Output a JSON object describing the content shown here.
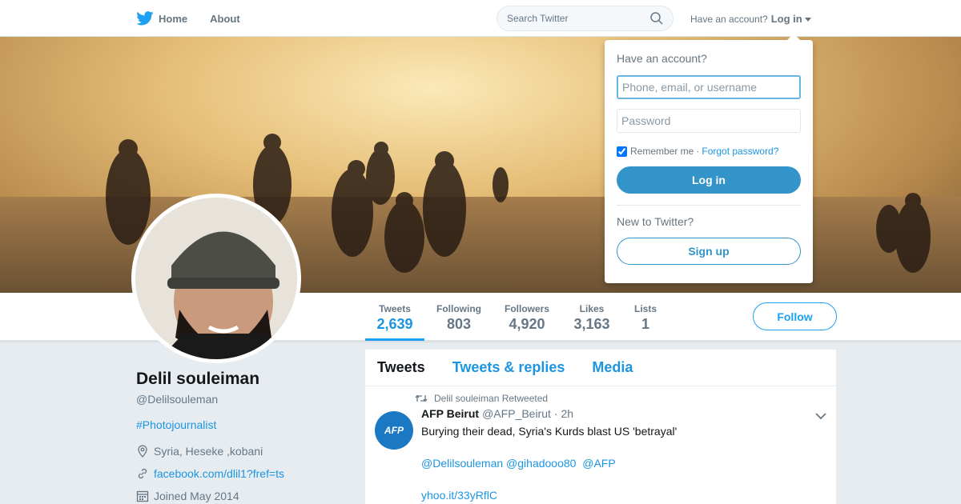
{
  "nav": {
    "home_label": "Home",
    "about_label": "About",
    "search_placeholder": "Search Twitter",
    "have_account_text": "Have an account?",
    "login_label": "Log in"
  },
  "profile": {
    "name": "Delil souleiman",
    "handle": "@Delilsouleman",
    "bio": "#Photojournalist",
    "location": "Syria, Heseke ,kobani",
    "website": "facebook.com/dlil1?fref=ts",
    "joined": "Joined May 2014",
    "follow_label": "Follow"
  },
  "stats": [
    {
      "label": "Tweets",
      "value": "2,639"
    },
    {
      "label": "Following",
      "value": "803"
    },
    {
      "label": "Followers",
      "value": "4,920"
    },
    {
      "label": "Likes",
      "value": "3,163"
    },
    {
      "label": "Lists",
      "value": "1"
    }
  ],
  "timeline": {
    "tabs": [
      "Tweets",
      "Tweets & replies",
      "Media"
    ],
    "tweet": {
      "retweet_label": "Delil souleiman Retweeted",
      "avatar_text": "AFP",
      "author_name": "AFP Beirut",
      "author_handle": "@AFP_Beirut",
      "time": "· 2h",
      "text": "Burying their dead, Syria's Kurds blast US 'betrayal'",
      "mentions": [
        "@Delilsouleman",
        "@gihadooo80",
        "@AFP"
      ],
      "link": "yhoo.it/33yRflC"
    }
  },
  "login_dropdown": {
    "title": "Have an account?",
    "username_placeholder": "Phone, email, or username",
    "password_placeholder": "Password",
    "remember_label": "Remember me",
    "separator": "·",
    "forgot_label": "Forgot password?",
    "login_button": "Log in",
    "new_text": "New to Twitter?",
    "signup_button": "Sign up"
  }
}
